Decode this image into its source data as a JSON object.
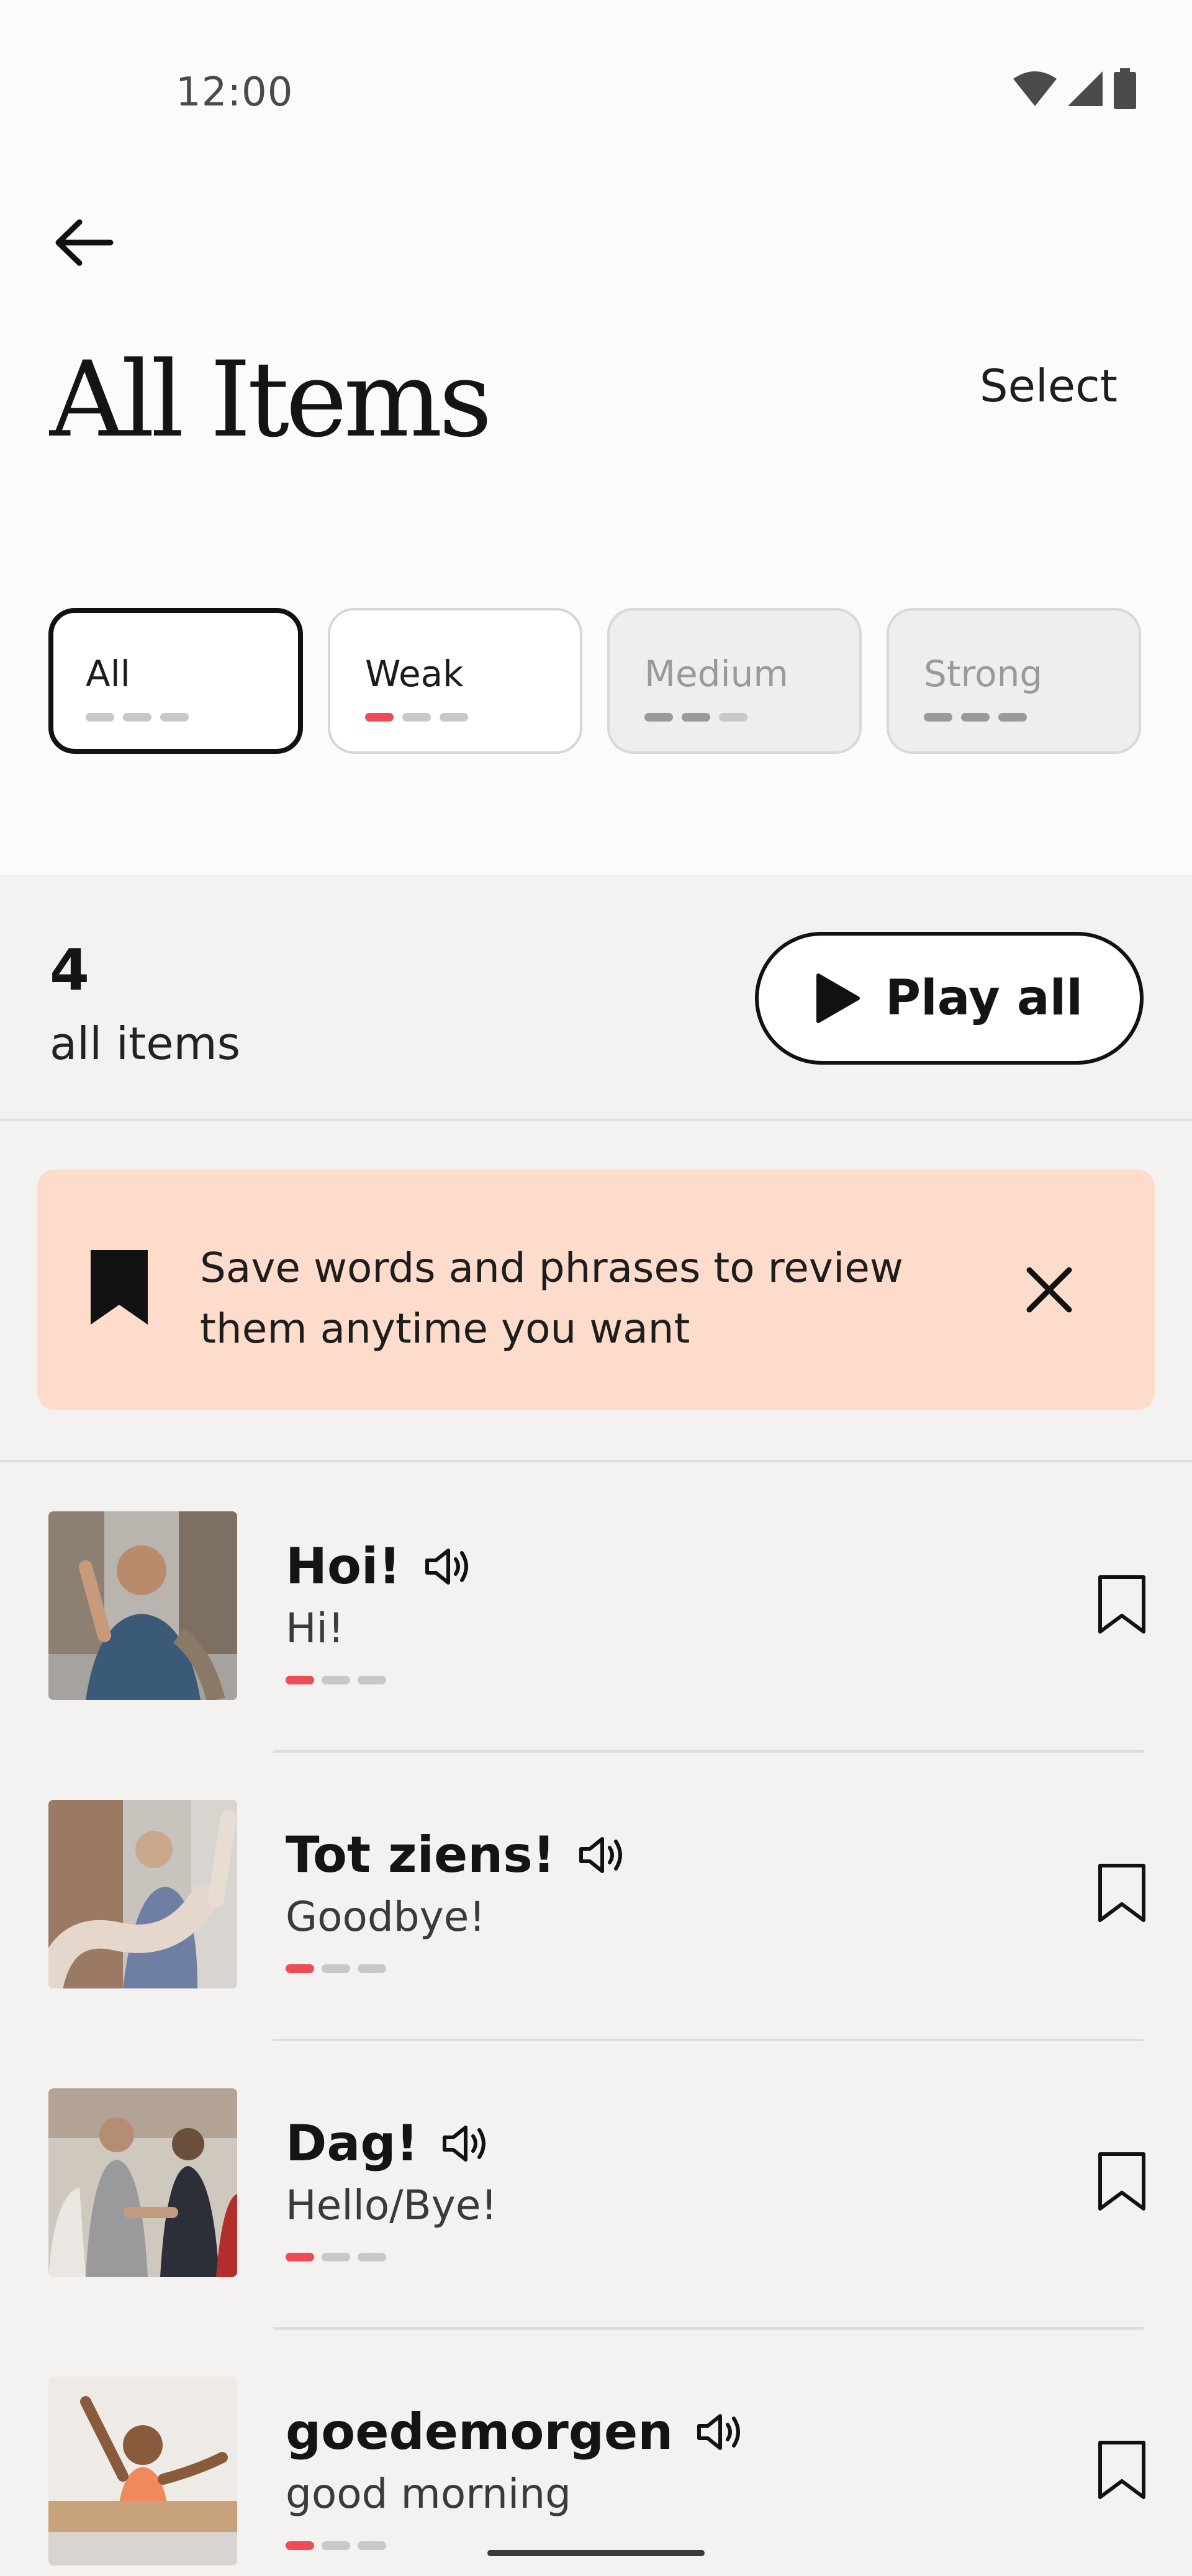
{
  "status_bar": {
    "time": "12:00"
  },
  "header": {
    "title": "All Items",
    "select_label": "Select"
  },
  "filters": [
    {
      "label": "All",
      "state": "active"
    },
    {
      "label": "Weak",
      "state": "normal"
    },
    {
      "label": "Medium",
      "state": "disabled"
    },
    {
      "label": "Strong",
      "state": "disabled"
    }
  ],
  "summary": {
    "count": "4",
    "label": "all items",
    "play_all_label": "Play all"
  },
  "banner": {
    "text": "Save words and phrases to review them anytime you want"
  },
  "items": [
    {
      "title": "Hoi!",
      "translation": "Hi!"
    },
    {
      "title": "Tot ziens!",
      "translation": "Goodbye!"
    },
    {
      "title": "Dag!",
      "translation": "Hello/Bye!"
    },
    {
      "title": "goedemorgen",
      "translation": "good morning"
    }
  ],
  "colors": {
    "weak": "#ee4b54",
    "banner_bg": "#fddccc"
  }
}
